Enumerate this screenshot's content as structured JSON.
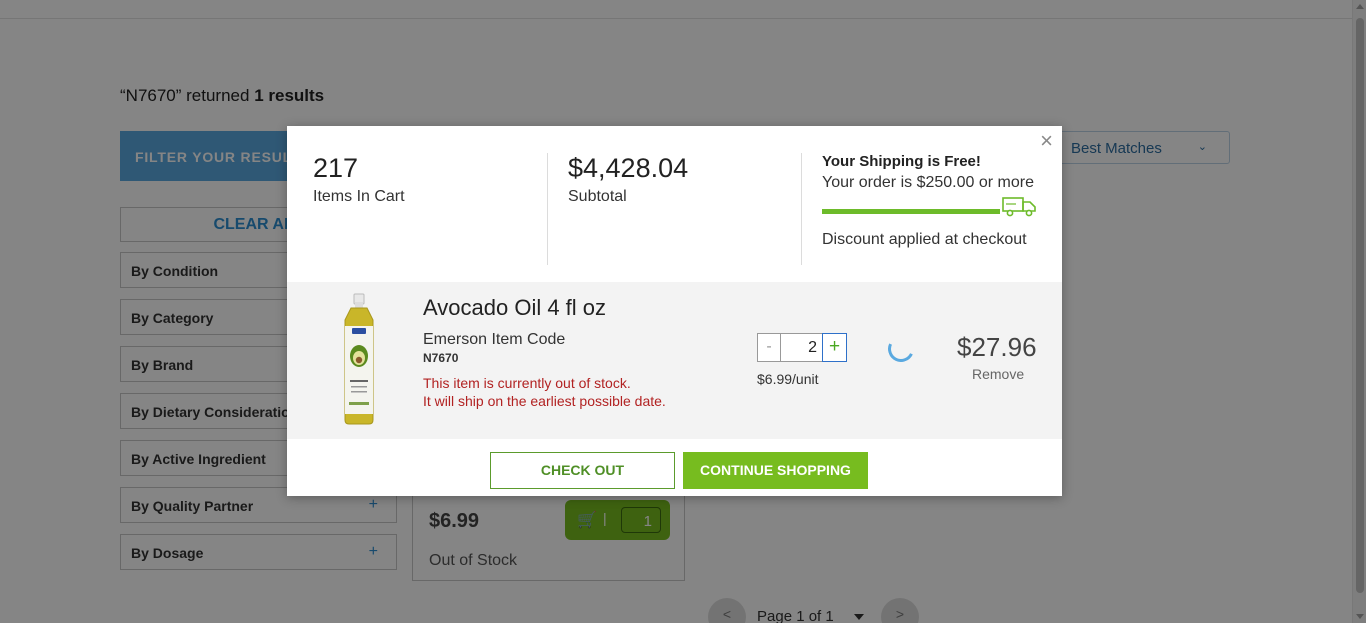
{
  "search": {
    "query_display": "“N7670” returned",
    "count_text": "1 results"
  },
  "filter_header": "FILTER YOUR RESULTS",
  "sort_select_value": "Best Matches",
  "clear_all": "CLEAR ALL",
  "filters": [
    {
      "label": "By Condition"
    },
    {
      "label": "By Category"
    },
    {
      "label": "By Brand"
    },
    {
      "label": "By Dietary Considerations"
    },
    {
      "label": "By Active Ingredient"
    },
    {
      "label": "By Quality Partner",
      "expand": "+"
    },
    {
      "label": "By Dosage",
      "expand": "+"
    }
  ],
  "product_card": {
    "price": "$6.99",
    "cart_qty": "1",
    "stock": "Out of Stock"
  },
  "pager": {
    "prev": "<",
    "next": ">",
    "text": "Page 1 of 1"
  },
  "modal": {
    "close": "×",
    "items_count": "217",
    "items_label": "Items In Cart",
    "subtotal": "$4,428.04",
    "subtotal_label": "Subtotal",
    "shipping_title": "Your Shipping is Free!",
    "shipping_sub": "Your order is $250.00 or more",
    "shipping_progress": 1.0,
    "discount_note": "Discount applied at checkout",
    "item": {
      "name": "Avocado Oil 4 fl oz",
      "code_label": "Emerson Item Code",
      "code": "N7670",
      "oos_line1": "This item is currently out of stock.",
      "oos_line2": "It will ship on the earliest possible date.",
      "qty_minus": "-",
      "qty": "2",
      "qty_plus": "+",
      "unit_price": "$6.99/unit",
      "line_total": "$27.96",
      "remove": "Remove"
    },
    "checkout_btn": "CHECK OUT",
    "continue_btn": "CONTINUE SHOPPING"
  },
  "colors": {
    "accent_green": "#77bc1f",
    "link_blue": "#2d8fd1",
    "warning_red": "#b22222",
    "spinner_blue": "#5aa9e0"
  }
}
